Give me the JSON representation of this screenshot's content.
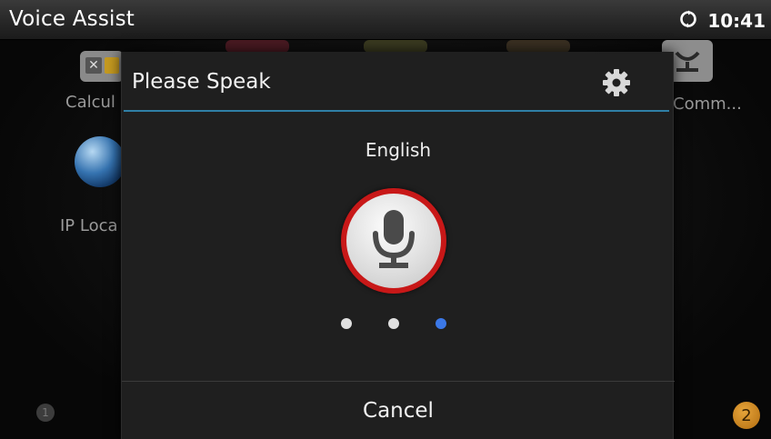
{
  "statusbar": {
    "title": "Voice Assist",
    "time": "10:41",
    "status_icon": "sync-icon"
  },
  "home": {
    "apps": [
      {
        "label": "Calcul",
        "icon": "calculator-icon"
      },
      {
        "label": "IP Loca",
        "icon": "globe-icon"
      },
      {
        "label": "Comm...",
        "icon": "headset-icon"
      }
    ],
    "badge_left": "1",
    "badge_right": "2"
  },
  "dialog": {
    "title": "Please Speak",
    "settings_icon": "gear-icon",
    "language": "English",
    "mic_icon": "microphone-icon",
    "dots": [
      {
        "color": "#e0e0e0",
        "active": false
      },
      {
        "color": "#e0e0e0",
        "active": false
      },
      {
        "color": "#3b78e7",
        "active": true
      }
    ],
    "cancel_label": "Cancel"
  },
  "colors": {
    "accent_rule": "#2f7fa6",
    "mic_ring": "#c81818",
    "active_dot": "#3b78e7"
  }
}
